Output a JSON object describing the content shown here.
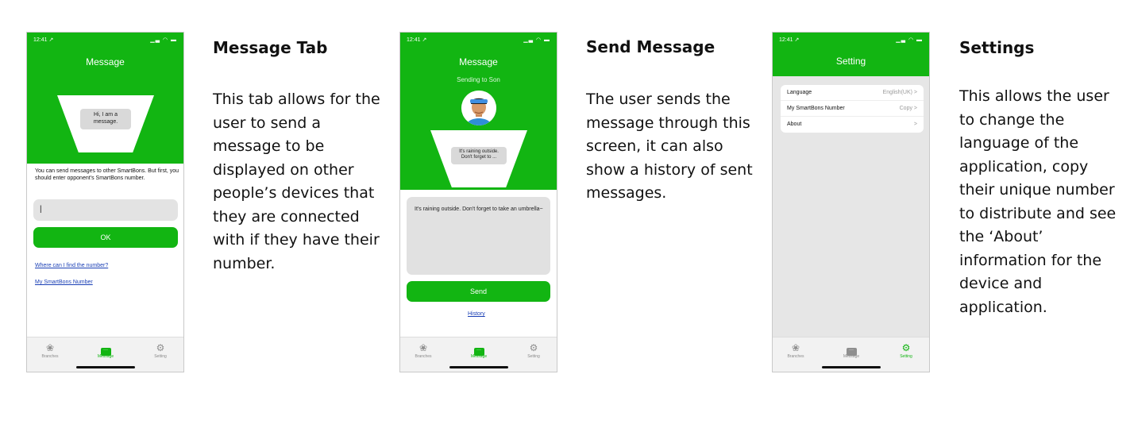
{
  "statusbar": {
    "time": "12:41 ↗",
    "icons": "▁▃ ◠ ▬"
  },
  "tabbar": {
    "branches": "Branches",
    "message": "Message",
    "setting": "Setting"
  },
  "screen1": {
    "title": "Message",
    "bubble": "Hi, I am a message.",
    "instructions": "You can send messages to other SmartBons. But first, you should enter opponent’s SmartBons number.",
    "input_value": "|",
    "ok_label": "OK",
    "link_find": "Where can I find the number?",
    "link_number": "My SmartBons Number"
  },
  "desc1": {
    "title": "Message Tab",
    "body": "This tab allows for the user to send a message to be displayed on other people’s devices that they are connected with if they have their number."
  },
  "screen2": {
    "title": "Message",
    "subtitle": "Sending to Son",
    "bubble": "It's raining outside. Don't forget to ...",
    "textarea_value": "It's raining outside. Don't forget to take an umbrella~",
    "send_label": "Send",
    "history_label": "History"
  },
  "desc2": {
    "title": "Send Message",
    "body": "The user sends the message through this screen, it can also show a history of sent messages."
  },
  "screen3": {
    "title": "Setting",
    "rows": [
      {
        "label": "Language",
        "value": "English(UK)  >"
      },
      {
        "label": "My SmartBons Number",
        "value": "Copy  >"
      },
      {
        "label": "About",
        "value": ">"
      }
    ]
  },
  "desc3": {
    "title": "Settings",
    "body": "This allows the user to change the language of the application, copy their unique number to distribute and see the ‘About’ information for the device and application."
  },
  "colors": {
    "brand_green": "#12b512",
    "link_blue": "#1a3fb5"
  }
}
